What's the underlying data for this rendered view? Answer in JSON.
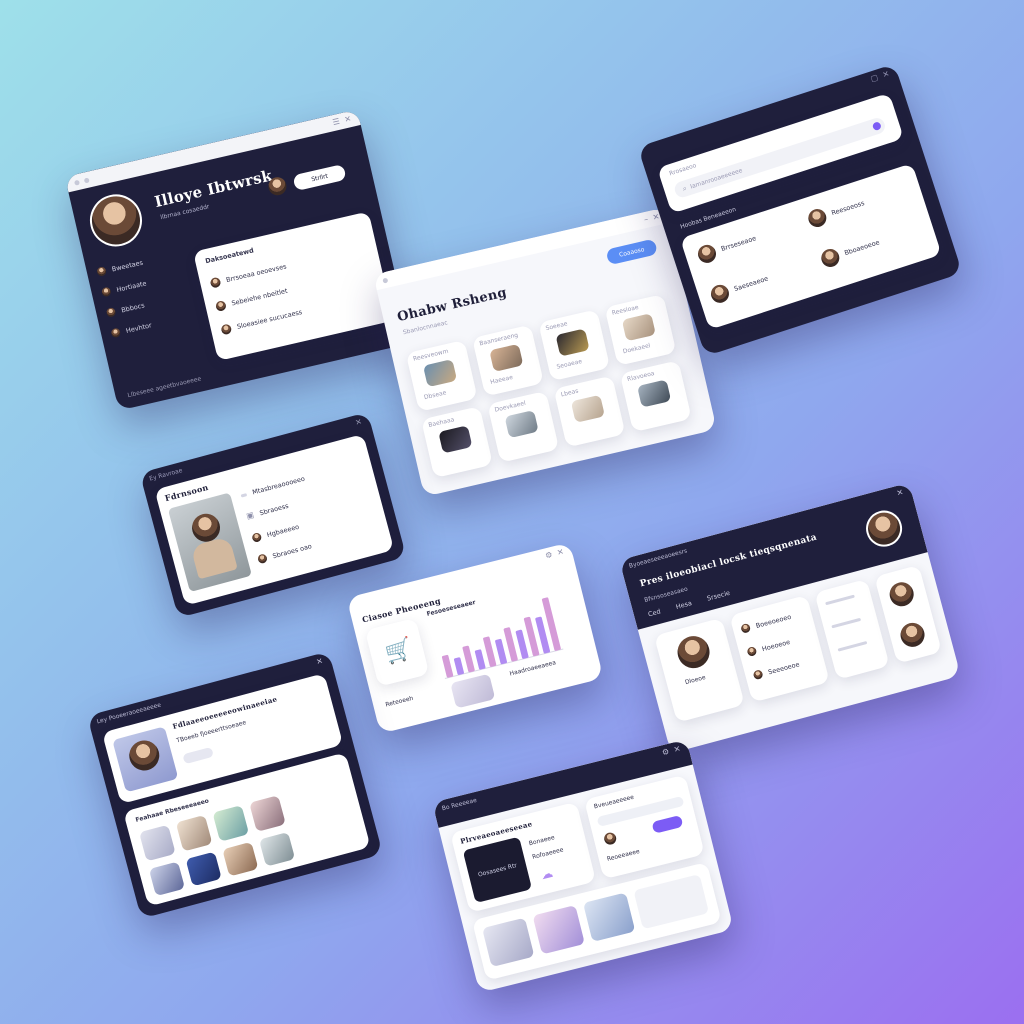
{
  "colors": {
    "dark": "#1f1f3c",
    "accent": "#7c5cf5",
    "blue": "#5b8ef5",
    "light": "#f6f7fb"
  },
  "card1": {
    "title": "Illoye Ibtwrsk",
    "subtitle": "llbrnaa cosaeddr",
    "button": "Strllrt",
    "sidebar": [
      "Bweetaes",
      "Hortiaate",
      "Bbbocs",
      "Hevhtor"
    ],
    "list_header": "Daksoeatewd",
    "rows": [
      "Brrsoeaa oeoevses",
      "Sebeiehe  nbeitlet",
      "Sloeasiee sucucaess"
    ],
    "footer": "Llbeseee ageetbvaoeeee"
  },
  "card2": {
    "title": "Ohabw Rsheng",
    "subtitle": "Sbanlocnnaeac",
    "button": "Coaaoso",
    "sections": [
      "Reesveowm",
      "Baanseraeng",
      "Soeeae",
      "Reesioae",
      "Baehaaa",
      "Doevkaeel",
      "Lbeas",
      "Rlavoeoa"
    ],
    "items": [
      "Dbseae",
      "Haeeae",
      "Seoaeae",
      "Doekaeel"
    ]
  },
  "card3": {
    "search_label": "Rrosaeoo",
    "search_placeholder": "Iamanrooaeeeeee",
    "section": "Hoobas Beneaeeon",
    "people": [
      "Brrseseaoe",
      "Reesoeoss",
      "Saeseaeoe",
      "Bboaeoeoe"
    ]
  },
  "card4": {
    "chrome": "Ey Ravroae",
    "title": "Fdrnsoon",
    "rows": [
      "Mtasbreaoooeeo",
      "Sbraoess",
      "Hgbaeeeo",
      "Sbraoes oao"
    ]
  },
  "card5": {
    "title": "Ciasoe Pheoeeng",
    "chart_label": "Fesoeseseaeer",
    "sub_a": "Haadroaeeaeea",
    "sub_b": "Reteoeeh"
  },
  "chart_data": {
    "type": "bar",
    "categories": [
      "",
      "",
      "",
      "",
      "",
      "",
      "",
      "",
      "",
      "",
      ""
    ],
    "values": [
      34,
      26,
      40,
      30,
      46,
      38,
      52,
      44,
      60,
      56,
      82
    ],
    "title": "",
    "xlabel": "",
    "ylabel": ""
  },
  "card6": {
    "chrome": "Byoeaeseeeaoeesrs",
    "title": "Pres iloeobiacl locsk tieqsqnenata",
    "subtitle": "Bfsnsoseasaeo",
    "tabs": [
      "Ced",
      "Hesa",
      "Srsecie"
    ],
    "profile": "Dloeoe",
    "people": [
      "Boeeoeoeo",
      "Hoeoeoe",
      "Seeeoeoe"
    ]
  },
  "card7": {
    "chrome": "Ley Pooeeraoeeaeeee",
    "title": "Fdlaaeeoeeeeeowinaeeiae",
    "subtitle": "TBoeeb fjoeeerttsoeaee",
    "section": "Feahaae Rbeseeeaeeo"
  },
  "card8": {
    "chrome": "Bo Reeeeae",
    "title": "Plrveaeoaeeseeae",
    "hero_label": "Oosasees Rtr",
    "items": [
      "Bonaeee",
      "Rofoaeeee",
      "Bveueaeeeee",
      "Reoeeaeee"
    ]
  }
}
